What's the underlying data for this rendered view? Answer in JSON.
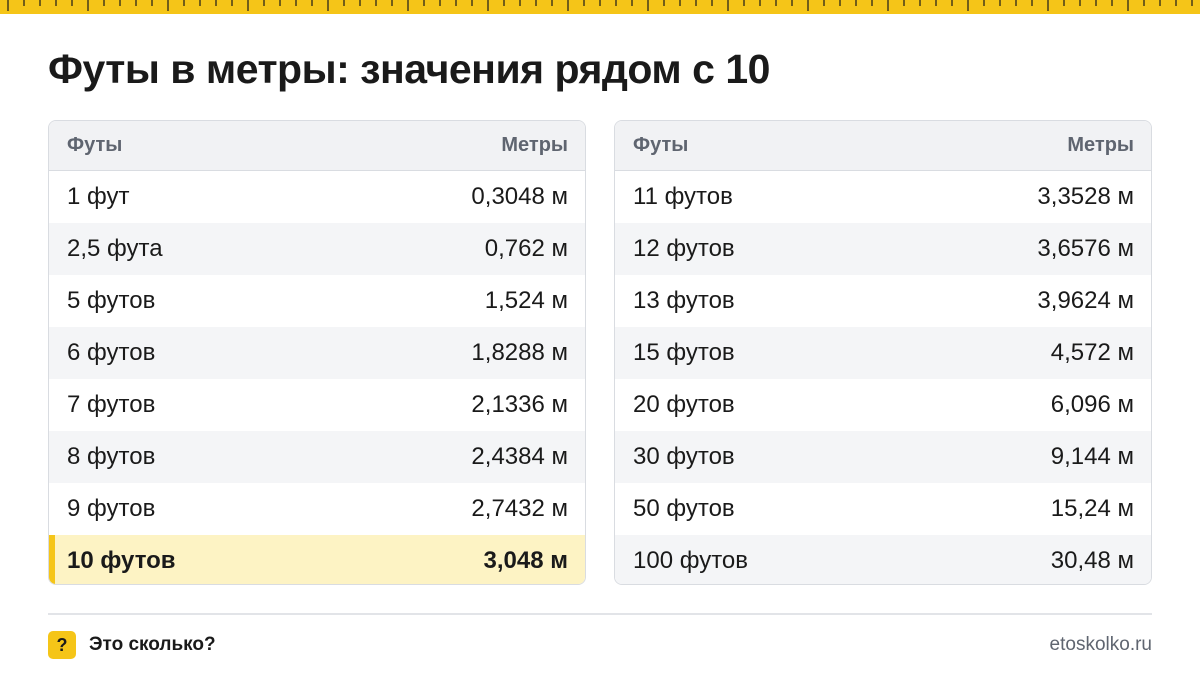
{
  "header": {
    "title": "Футы в метры: значения рядом с 10"
  },
  "tables": [
    {
      "col_feet": "Футы",
      "col_meters": "Метры",
      "rows": [
        {
          "feet": "1 фут",
          "meters": "0,3048 м"
        },
        {
          "feet": "2,5 фута",
          "meters": "0,762 м"
        },
        {
          "feet": "5 футов",
          "meters": "1,524 м"
        },
        {
          "feet": "6 футов",
          "meters": "1,8288 м"
        },
        {
          "feet": "7 футов",
          "meters": "2,1336 м"
        },
        {
          "feet": "8 футов",
          "meters": "2,4384 м"
        },
        {
          "feet": "9 футов",
          "meters": "2,7432 м"
        },
        {
          "feet": "10 футов",
          "meters": "3,048 м",
          "highlighted": true
        }
      ]
    },
    {
      "col_feet": "Футы",
      "col_meters": "Метры",
      "rows": [
        {
          "feet": "11 футов",
          "meters": "3,3528 м"
        },
        {
          "feet": "12 футов",
          "meters": "3,6576 м"
        },
        {
          "feet": "13 футов",
          "meters": "3,9624 м"
        },
        {
          "feet": "15 футов",
          "meters": "4,572 м"
        },
        {
          "feet": "20 футов",
          "meters": "6,096 м"
        },
        {
          "feet": "30 футов",
          "meters": "9,144 м"
        },
        {
          "feet": "50 футов",
          "meters": "15,24 м"
        },
        {
          "feet": "100 футов",
          "meters": "30,48 м"
        }
      ]
    }
  ],
  "footer": {
    "icon_glyph": "?",
    "brand": "Это сколько?",
    "site": "etoskolko.ru"
  },
  "colors": {
    "accent": "#f5c518",
    "highlight_row": "#fdf3c4",
    "header_bg": "#f1f2f4",
    "alt_row": "#f4f5f7",
    "muted_text": "#5f6570"
  }
}
